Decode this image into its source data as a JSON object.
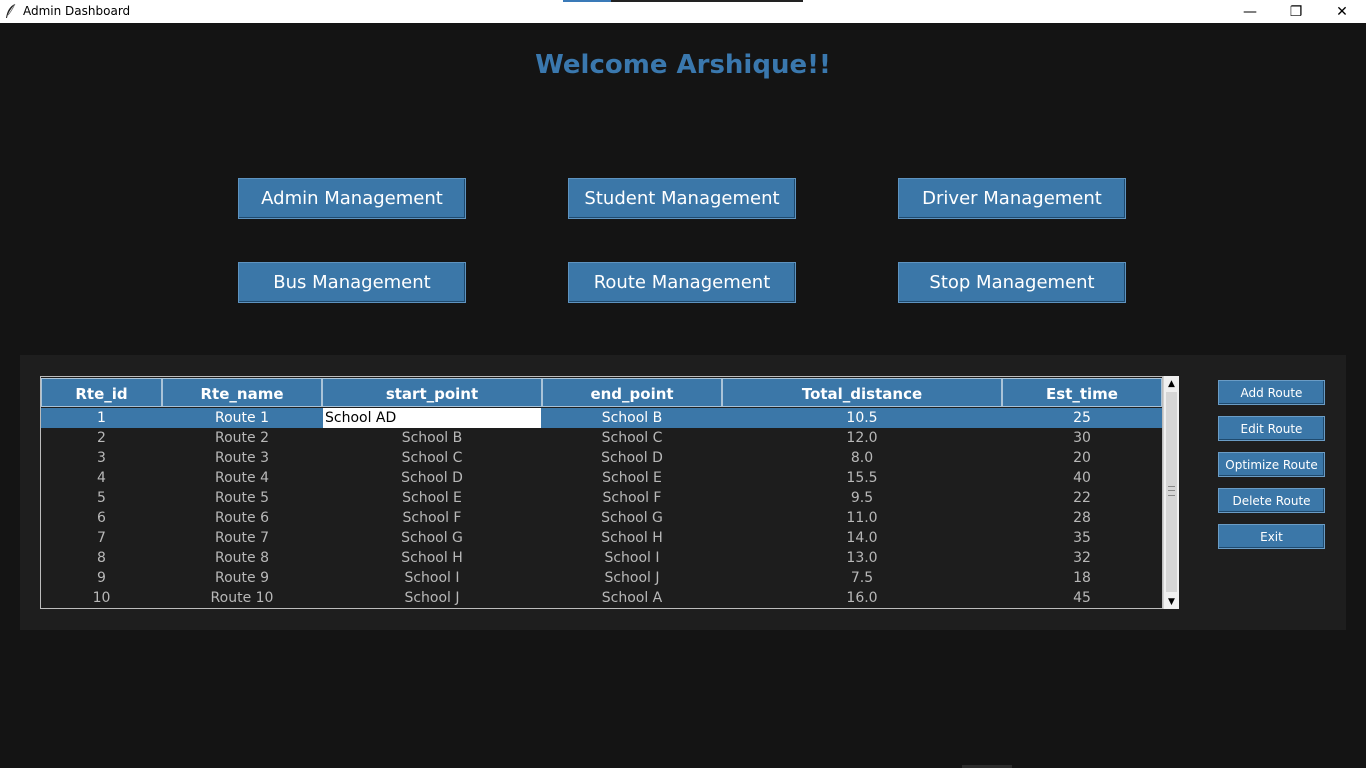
{
  "window": {
    "title": "Admin Dashboard",
    "minimize": "—",
    "restore": "❐",
    "close": "✕"
  },
  "header": {
    "welcome": "Welcome Arshique!!"
  },
  "management": {
    "admin": "Admin Management",
    "student": "Student Management",
    "driver": "Driver Management",
    "bus": "Bus Management",
    "route": "Route Management",
    "stop": "Stop Management"
  },
  "table": {
    "columns": [
      "Rte_id",
      "Rte_name",
      "start_point",
      "end_point",
      "Total_distance",
      "Est_time"
    ],
    "editing_value": "School AD",
    "rows": [
      [
        "1",
        "Route 1",
        "School AD",
        "School B",
        "10.5",
        "25"
      ],
      [
        "2",
        "Route 2",
        "School B",
        "School C",
        "12.0",
        "30"
      ],
      [
        "3",
        "Route 3",
        "School C",
        "School D",
        "8.0",
        "20"
      ],
      [
        "4",
        "Route 4",
        "School D",
        "School E",
        "15.5",
        "40"
      ],
      [
        "5",
        "Route 5",
        "School E",
        "School F",
        "9.5",
        "22"
      ],
      [
        "6",
        "Route 6",
        "School F",
        "School G",
        "11.0",
        "28"
      ],
      [
        "7",
        "Route 7",
        "School G",
        "School H",
        "14.0",
        "35"
      ],
      [
        "8",
        "Route 8",
        "School H",
        "School I",
        "13.0",
        "32"
      ],
      [
        "9",
        "Route 9",
        "School I",
        "School J",
        "7.5",
        "18"
      ],
      [
        "10",
        "Route 10",
        "School J",
        "School A",
        "16.0",
        "45"
      ]
    ],
    "selected_row": 0
  },
  "actions": {
    "add": "Add Route",
    "edit": "Edit Route",
    "optimize": "Optimize Route",
    "delete": "Delete Route",
    "exit": "Exit"
  },
  "scroll": {
    "up": "▲",
    "down": "▼"
  },
  "colors": {
    "accent": "#3b77a8",
    "welcome": "#3a78ae",
    "background": "#141414",
    "panel": "#1e1e1e"
  }
}
